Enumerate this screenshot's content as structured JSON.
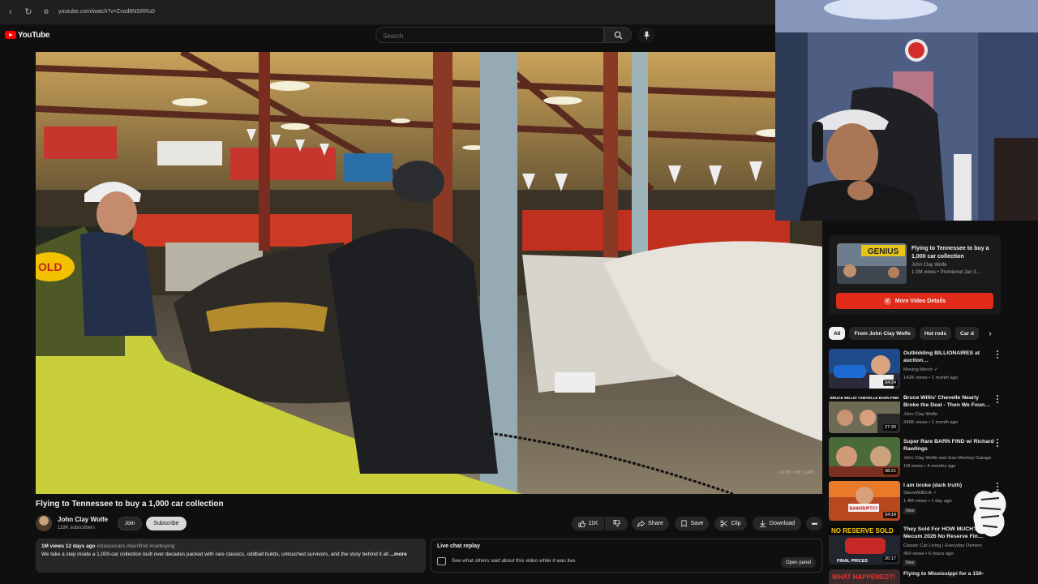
{
  "browser": {
    "url": "youtube.com/watch?v=Zvod8NSRRu0"
  },
  "masthead": {
    "logo_text": "YouTube",
    "search_placeholder": "Search"
  },
  "video": {
    "title": "Flying to Tennessee to buy a 1,000 car collection",
    "channel": "John Clay Wolfe",
    "subscribers": "118K subscribers",
    "join_label": "Join",
    "subscribe_label": "Subscribe",
    "actions": {
      "likes": "11K",
      "share": "Share",
      "save": "Save",
      "clip": "Clip",
      "download": "Download"
    },
    "watermark": "GIVE THE CAR"
  },
  "description": {
    "stats": "1M views  12 days ago",
    "tags": "#classiccars #barnfind #carbuying",
    "text": "We take a step inside a 1,000-car collection built over decades packed with rare classics, oddball builds, untouched survivors, and the story behind it all",
    "more": "...more"
  },
  "chat_replay": {
    "title": "Live chat replay",
    "subtitle": "See what others said about this video while it was live.",
    "open_panel": "Open panel"
  },
  "promo": {
    "thumb_text": "GENIUS",
    "title": "Flying to Tennessee to buy a 1,000 car collection",
    "channel": "John Clay Wolfe",
    "meta": "1.0M views • Premiered Jan 3,…",
    "button": "More Video Details"
  },
  "chips": [
    "All",
    "From John Clay Wolfe",
    "Hot rods",
    "Car d"
  ],
  "recommendations": [
    {
      "title": "Outbidding BILLIONAIRES at auction…",
      "channel": "Moving Merch",
      "verified": true,
      "meta": "142K views • 1 month ago",
      "duration": "34:24",
      "badge": ""
    },
    {
      "title": "Bruce Willis' Chevelle Nearly Broke the Deal - Then We Foun…",
      "channel": "John Clay Wolfe",
      "verified": false,
      "meta": "340K views • 1 month ago",
      "duration": "27:30",
      "badge": "",
      "thumb_text": "BRUCE WILLIS' CHEVELLE BARN FIND"
    },
    {
      "title": "Super Rare BARN FIND w/ Richard Rawlings",
      "channel": "John Clay Wolfe and Gas Monkey Garage",
      "verified": false,
      "meta": "1M views • 4 months ago",
      "duration": "38:21",
      "badge": ""
    },
    {
      "title": "I am broke (dark truth)",
      "channel": "SteveWillDoIt",
      "verified": true,
      "meta": "1.4M views • 1 day ago",
      "duration": "34:14",
      "badge": "New",
      "thumb_text": "BANKRUPTCY"
    },
    {
      "title": "They Sold For HOW MUCH?! Mecum 2026 No Reserve Fin…",
      "channel": "Classic Car Living | Everyday Owners",
      "verified": false,
      "meta": "450 views • 6 hours ago",
      "duration": "20:17",
      "badge": "New",
      "thumb_text": "NO RESERVE SOLD",
      "thumb_text2": "FINAL PRICES"
    },
    {
      "title": "Flying to Mississippi for a 150-",
      "channel": "",
      "verified": false,
      "meta": "",
      "duration": "",
      "badge": "",
      "thumb_text": "WHAT HAPPENED?!"
    }
  ],
  "colors": {
    "background": "#0f0f0f",
    "accent_red": "#ff0000",
    "promo_button": "#e12b1a"
  }
}
